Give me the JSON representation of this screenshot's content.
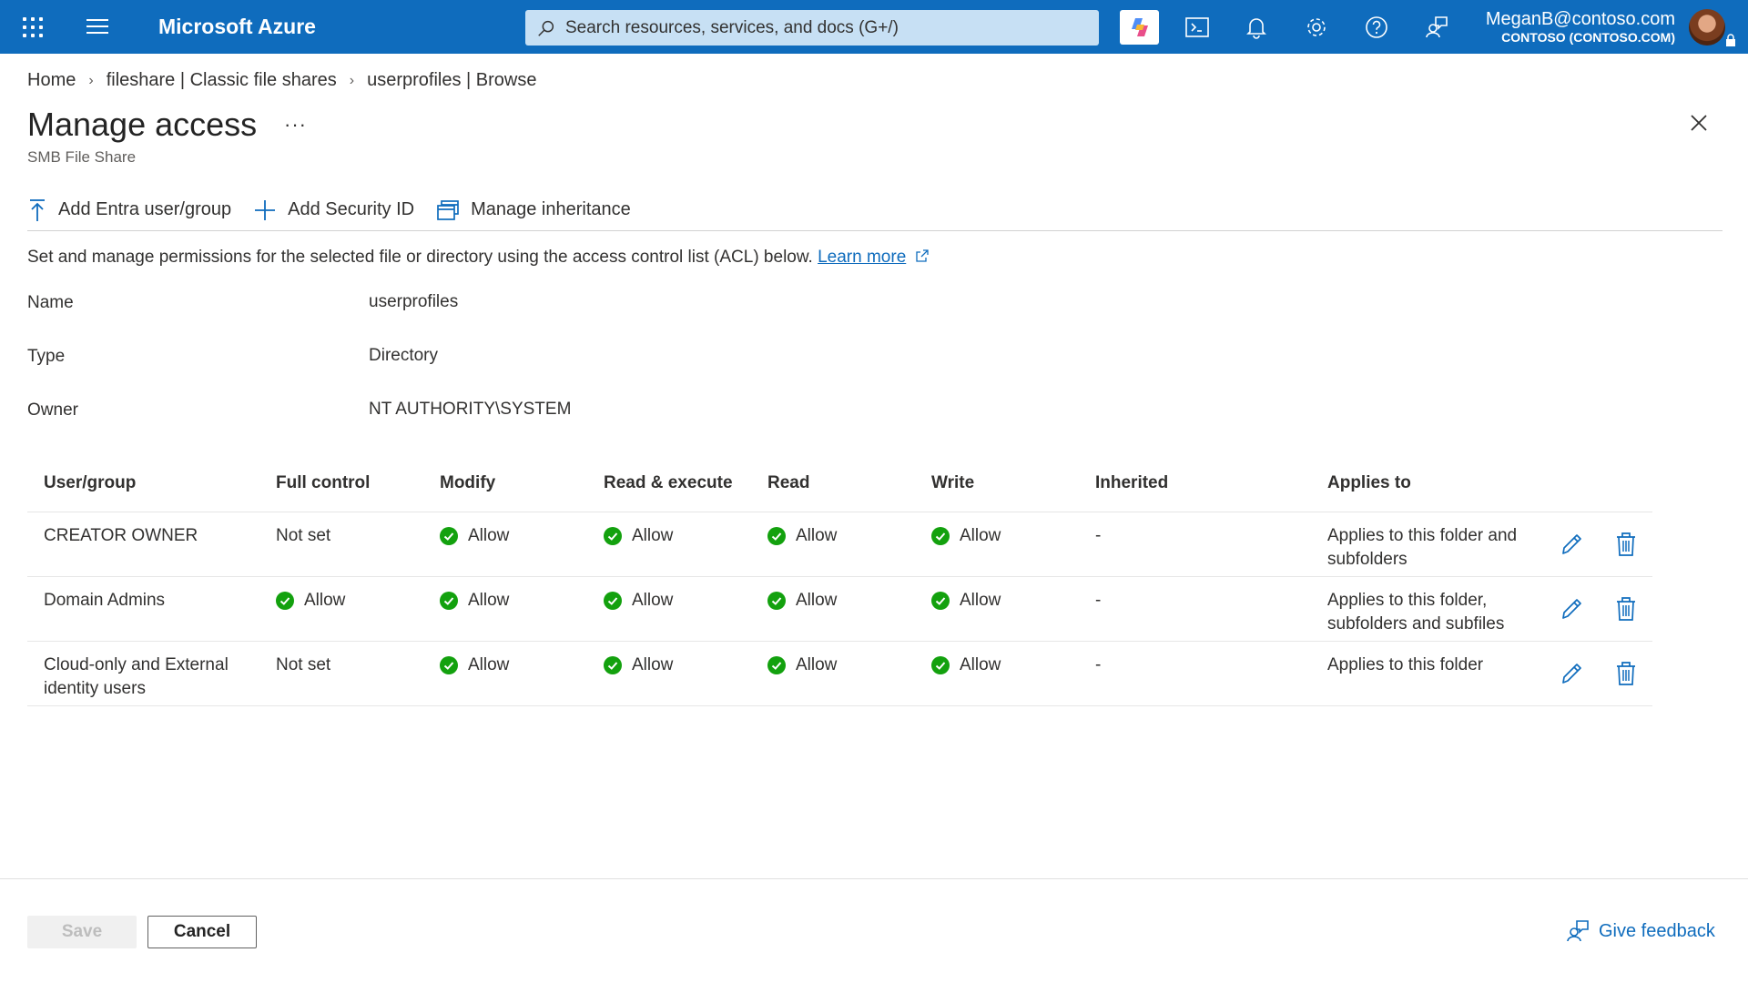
{
  "topbar": {
    "brand": "Microsoft Azure",
    "search_placeholder": "Search resources, services, and docs (G+/)",
    "account_email": "MeganB@contoso.com",
    "account_tenant": "CONTOSO (CONTOSO.COM)",
    "icons": [
      "waffle-icon",
      "hamburger-icon",
      "copilot-icon",
      "cloud-shell-icon",
      "bell-icon",
      "gear-icon",
      "help-icon",
      "feedback-icon"
    ],
    "accent_color": "#0f6cbd"
  },
  "breadcrumb": {
    "items": [
      "Home",
      "fileshare | Classic file shares",
      "userprofiles | Browse"
    ]
  },
  "header": {
    "title": "Manage access",
    "more": "···",
    "subtitle": "SMB File Share"
  },
  "commands": {
    "add_entra": "Add Entra user/group",
    "add_sid": "Add Security ID",
    "manage_inheritance": "Manage inheritance"
  },
  "description": {
    "text": "Set and manage permissions for the selected file or directory using the access control list (ACL) below.",
    "link": "Learn more"
  },
  "properties": {
    "name_label": "Name",
    "name_value": "userprofiles",
    "type_label": "Type",
    "type_value": "Directory",
    "owner_label": "Owner",
    "owner_value": "NT AUTHORITY\\SYSTEM"
  },
  "table": {
    "columns": [
      "User/group",
      "Full control",
      "Modify",
      "Read & execute",
      "Read",
      "Write",
      "Inherited",
      "Applies to"
    ],
    "rows": [
      {
        "user": [
          "CREATOR OWNER"
        ],
        "full_control": "Not set",
        "modify": "Allow",
        "read_execute": "Allow",
        "read": "Allow",
        "write": "Allow",
        "inherited": "-",
        "applies_to": [
          "Applies to this folder and",
          "subfolders"
        ]
      },
      {
        "user": [
          "Domain Admins"
        ],
        "full_control": "Allow",
        "modify": "Allow",
        "read_execute": "Allow",
        "read": "Allow",
        "write": "Allow",
        "inherited": "-",
        "applies_to": [
          "Applies to this folder,",
          "subfolders and subfiles"
        ]
      },
      {
        "user": [
          "Cloud-only and External",
          "identity users"
        ],
        "full_control": "Not set",
        "modify": "Allow",
        "read_execute": "Allow",
        "read": "Allow",
        "write": "Allow",
        "inherited": "-",
        "applies_to": [
          "Applies to this folder"
        ]
      }
    ],
    "allow_color": "#13a10e"
  },
  "footer": {
    "save": "Save",
    "cancel": "Cancel",
    "feedback": "Give feedback"
  }
}
